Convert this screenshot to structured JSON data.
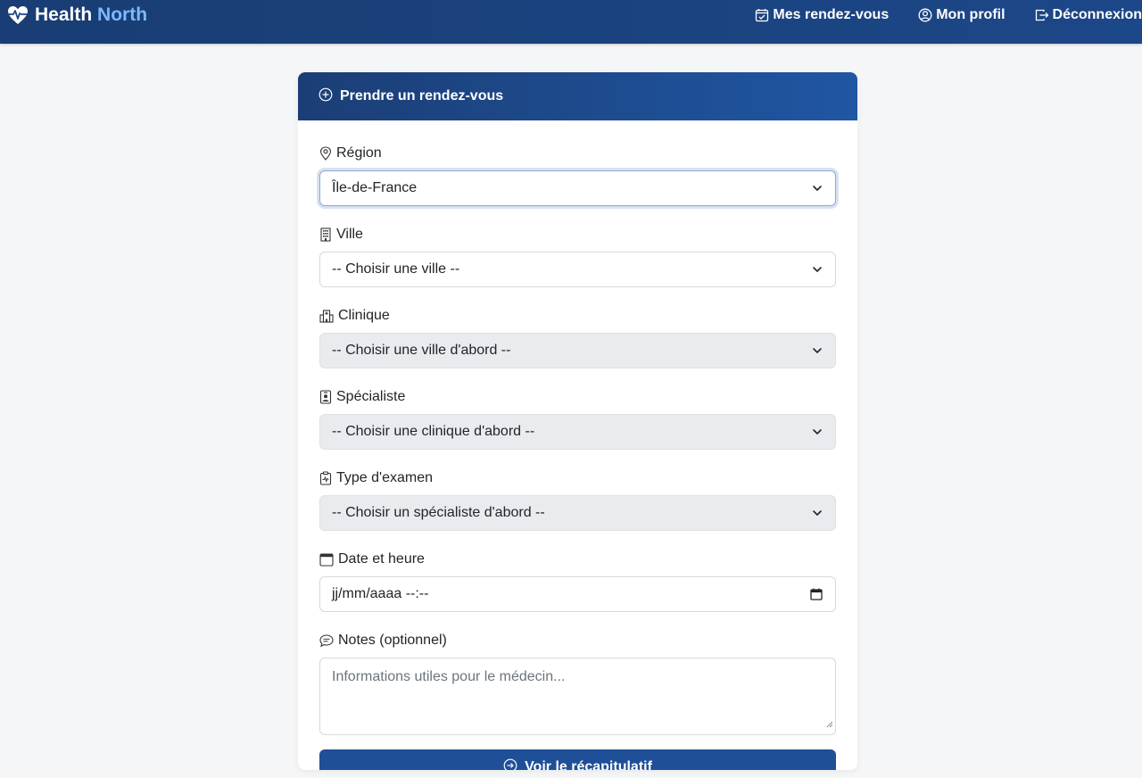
{
  "brand": {
    "name_part1": "Health",
    "name_part2": "North",
    "icon": "heart-pulse-icon"
  },
  "nav": {
    "items": [
      {
        "label": "Mes rendez-vous",
        "icon": "calendar-check-icon"
      },
      {
        "label": "Mon profil",
        "icon": "person-circle-icon"
      },
      {
        "label": "Déconnexion",
        "icon": "box-arrow-right-icon"
      }
    ]
  },
  "card": {
    "title": "Prendre un rendez-vous",
    "title_icon": "plus-circle-icon"
  },
  "form": {
    "region": {
      "label": "Région",
      "icon": "geo-alt-icon",
      "value": "Île-de-France"
    },
    "ville": {
      "label": "Ville",
      "icon": "building-icon",
      "value": "-- Choisir une ville --"
    },
    "clinique": {
      "label": "Clinique",
      "icon": "hospital-icon",
      "value": "-- Choisir une ville d'abord --",
      "disabled": true
    },
    "specialiste": {
      "label": "Spécialiste",
      "icon": "person-badge-icon",
      "value": "-- Choisir une clinique d'abord --",
      "disabled": true
    },
    "type_examen": {
      "label": "Type d'examen",
      "icon": "clipboard-pulse-icon",
      "value": "-- Choisir un spécialiste d'abord --",
      "disabled": true
    },
    "date": {
      "label": "Date et heure",
      "icon": "calendar-icon",
      "value": "jj/mm/aaaa --:--"
    },
    "notes": {
      "label": "Notes (optionnel)",
      "icon": "chat-icon",
      "placeholder": "Informations utiles pour le médecin..."
    },
    "submit": {
      "label": "Voir le récapitulatif",
      "icon": "arrow-right-circle-icon"
    }
  },
  "colors": {
    "navbar": "#1c4788",
    "brand_accent": "#7eb8ff",
    "primary_button": "#1f4f97",
    "disabled_field": "#e9ecef",
    "page_background": "#f5f6f8"
  }
}
